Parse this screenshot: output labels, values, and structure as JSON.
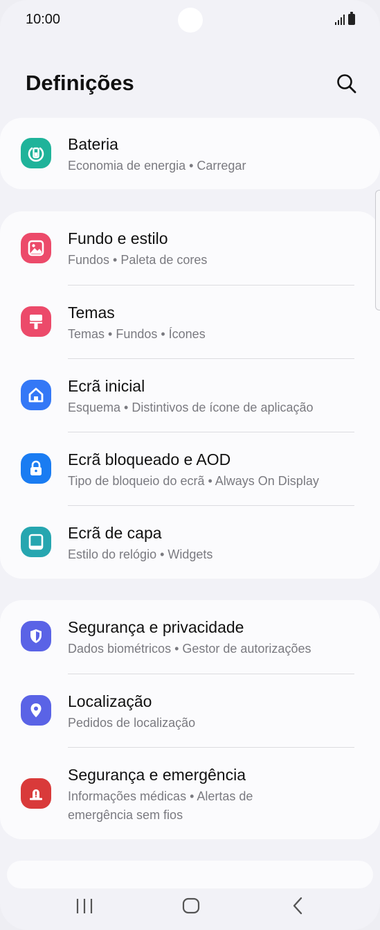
{
  "status_bar": {
    "time": "10:00"
  },
  "header": {
    "title": "Definições"
  },
  "groups": [
    {
      "items": [
        {
          "title": "Bateria",
          "subtitle": "Economia de energia  •  Carregar",
          "icon": "battery-icon",
          "color": "#1fb39a"
        }
      ]
    },
    {
      "items": [
        {
          "title": "Fundo e estilo",
          "subtitle": "Fundos  •  Paleta de cores",
          "icon": "wallpaper-icon",
          "color": "#ec4a6a"
        },
        {
          "title": "Temas",
          "subtitle": "Temas  •  Fundos  •  Ícones",
          "icon": "paintbrush-icon",
          "color": "#ec4a6a"
        },
        {
          "title": "Ecrã inicial",
          "subtitle": "Esquema  •  Distintivos de ícone de aplicação",
          "icon": "home-icon",
          "color": "#3478f6"
        },
        {
          "title": "Ecrã bloqueado e AOD",
          "subtitle": "Tipo de bloqueio do ecrã  •  Always On Display",
          "icon": "lock-icon",
          "color": "#1a7cf2"
        },
        {
          "title": "Ecrã de capa",
          "subtitle": "Estilo do relógio  •  Widgets",
          "icon": "cover-screen-icon",
          "color": "#26a6b0"
        }
      ]
    },
    {
      "items": [
        {
          "title": "Segurança e privacidade",
          "subtitle": "Dados biométricos  •  Gestor de autorizações",
          "icon": "shield-icon",
          "color": "#5a63e6"
        },
        {
          "title": "Localização",
          "subtitle": "Pedidos de localização",
          "icon": "location-pin-icon",
          "color": "#5a63e6"
        },
        {
          "title": "Segurança e emergência",
          "subtitle": "Informações médicas  •  Alertas de emergência sem fios",
          "icon": "emergency-icon",
          "color": "#d93a3a"
        }
      ]
    }
  ],
  "navbar": {
    "recents": "recents-icon",
    "home": "home-nav-icon",
    "back": "back-icon"
  }
}
